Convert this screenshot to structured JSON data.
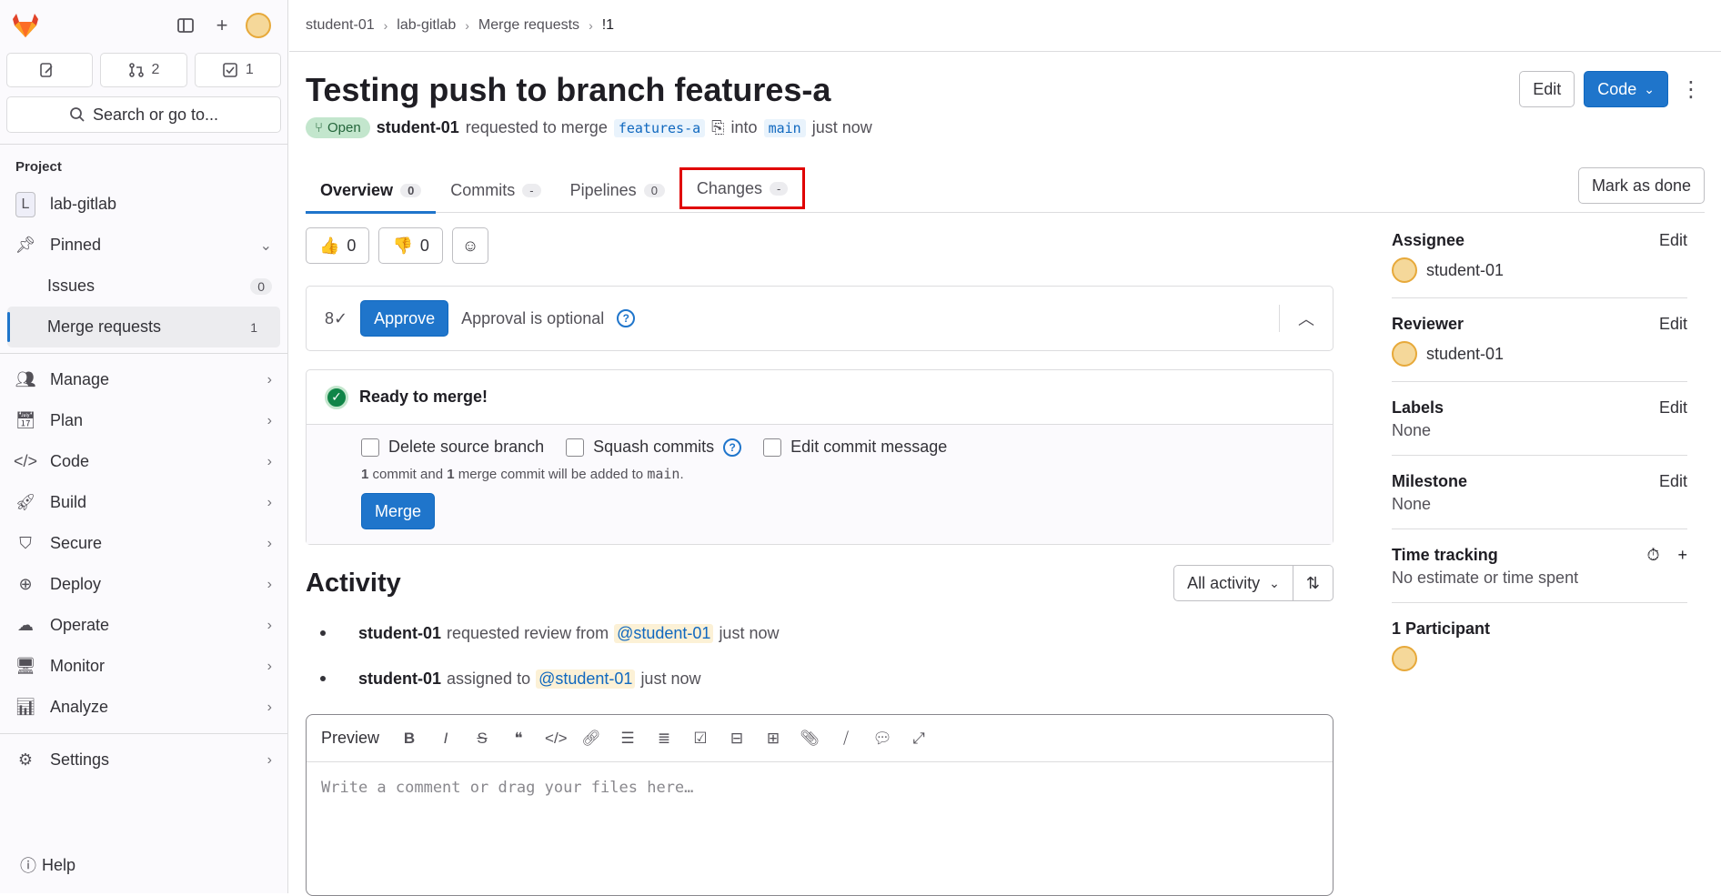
{
  "sidebar": {
    "counters": [
      {
        "label": ""
      },
      {
        "label": "2"
      },
      {
        "label": "1"
      }
    ],
    "search_label": "Search or go to...",
    "section": "Project",
    "project_name": "lab-gitlab",
    "project_initial": "L",
    "pinned": "Pinned",
    "issues": {
      "label": "Issues",
      "count": "0"
    },
    "merge_requests": {
      "label": "Merge requests",
      "count": "1"
    },
    "items": [
      {
        "label": "Manage",
        "icon": "users-icon"
      },
      {
        "label": "Plan",
        "icon": "calendar-icon"
      },
      {
        "label": "Code",
        "icon": "code-icon"
      },
      {
        "label": "Build",
        "icon": "rocket-icon"
      },
      {
        "label": "Secure",
        "icon": "shield-icon"
      },
      {
        "label": "Deploy",
        "icon": "deploy-icon"
      },
      {
        "label": "Operate",
        "icon": "cloud-icon"
      },
      {
        "label": "Monitor",
        "icon": "monitor-icon"
      },
      {
        "label": "Analyze",
        "icon": "chart-icon"
      }
    ],
    "settings": "Settings",
    "help": "Help"
  },
  "breadcrumb": [
    "student-01",
    "lab-gitlab",
    "Merge requests",
    "!1"
  ],
  "mr": {
    "title": "Testing push to branch features-a",
    "status": "Open",
    "author": "student-01",
    "requested": "requested to merge",
    "source_branch": "features-a",
    "into": "into",
    "target_branch": "main",
    "time": "just now"
  },
  "header": {
    "edit": "Edit",
    "code": "Code"
  },
  "tabs": [
    {
      "label": "Overview",
      "count": "0"
    },
    {
      "label": "Commits",
      "count": "-"
    },
    {
      "label": "Pipelines",
      "count": "0"
    },
    {
      "label": "Changes",
      "count": "-"
    }
  ],
  "mark_done": "Mark as done",
  "reactions": {
    "thumbs_up": "0",
    "thumbs_down": "0"
  },
  "approval": {
    "button": "Approve",
    "text": "Approval is optional"
  },
  "merge": {
    "status": "Ready to merge!",
    "delete_branch": "Delete source branch",
    "squash": "Squash commits",
    "edit_message": "Edit commit message",
    "info_1": "1",
    "info_2": " commit and ",
    "info_3": "1",
    "info_4": " merge commit will be added to ",
    "info_branch": "main",
    "info_end": ".",
    "button": "Merge"
  },
  "activity": {
    "title": "Activity",
    "filter": "All activity",
    "items": [
      {
        "user": "student-01",
        "action": "requested review from",
        "mention": "@student-01",
        "time": "just now"
      },
      {
        "user": "student-01",
        "action": "assigned to",
        "mention": "@student-01",
        "time": "just now"
      }
    ]
  },
  "editor": {
    "preview": "Preview",
    "placeholder": "Write a comment or drag your files here…"
  },
  "right": {
    "assignee": {
      "title": "Assignee",
      "edit": "Edit",
      "user": "student-01"
    },
    "reviewer": {
      "title": "Reviewer",
      "edit": "Edit",
      "user": "student-01"
    },
    "labels": {
      "title": "Labels",
      "edit": "Edit",
      "value": "None"
    },
    "milestone": {
      "title": "Milestone",
      "edit": "Edit",
      "value": "None"
    },
    "time_tracking": {
      "title": "Time tracking",
      "value": "No estimate or time spent"
    },
    "participants": {
      "title": "1 Participant"
    }
  },
  "colors": {
    "primary": "#1f75cb",
    "highlight": "#e00000",
    "success": "#108548"
  }
}
